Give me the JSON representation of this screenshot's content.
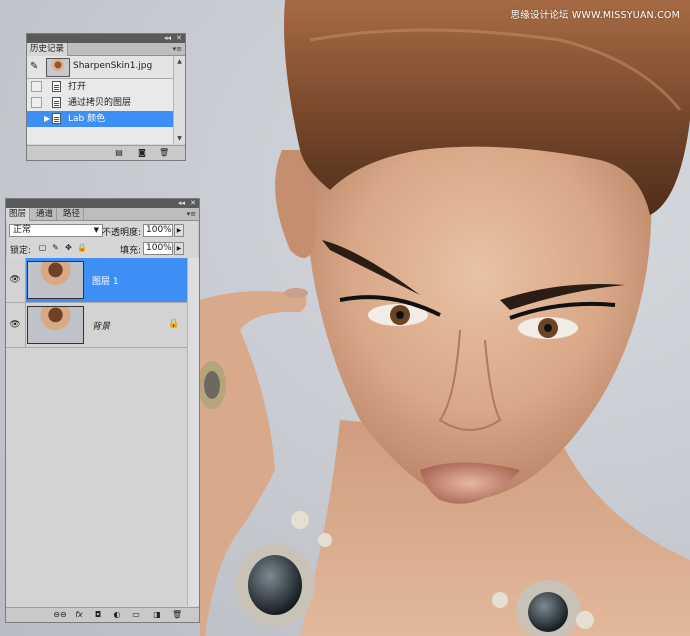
{
  "watermark": "思缘设计论坛 WWW.MISSYUAN.COM",
  "history_panel": {
    "tab_label": "历史记录",
    "snapshot_name": "SharpenSkin1.jpg",
    "items": [
      {
        "label": "打开",
        "selected": false
      },
      {
        "label": "通过拷贝的图层",
        "selected": false
      },
      {
        "label": "Lab 颜色",
        "selected": true
      }
    ],
    "collapse_glyph": "◂◂",
    "close_glyph": "✕",
    "menu_glyph": "▾≡"
  },
  "layers_panel": {
    "tabs": [
      {
        "label": "图层",
        "active": true
      },
      {
        "label": "通道",
        "active": false
      },
      {
        "label": "路径",
        "active": false
      }
    ],
    "blend_mode": "正常",
    "opacity_label": "不透明度:",
    "opacity_value": "100%",
    "lock_label": "锁定:",
    "fill_label": "填充:",
    "fill_value": "100%",
    "layers": [
      {
        "name": "图层 1",
        "visible": true,
        "selected": true,
        "locked": false
      },
      {
        "name": "背景",
        "visible": true,
        "selected": false,
        "locked": true
      }
    ],
    "bottom_icons": [
      "link-icon",
      "fx-icon",
      "mask-icon",
      "adjustment-icon",
      "group-icon",
      "new-layer-icon",
      "trash-icon"
    ],
    "bottom_glyphs": [
      "⊖⊖",
      "fx",
      "◘",
      "◐",
      "▭",
      "◨",
      "🗑"
    ],
    "collapse_glyph": "◂◂",
    "close_glyph": "✕",
    "menu_glyph": "▾≡"
  },
  "colors": {
    "selection": "#3d8ef5",
    "panel_bg": "#d6d6d6",
    "panel_title": "#5a5a5a"
  }
}
